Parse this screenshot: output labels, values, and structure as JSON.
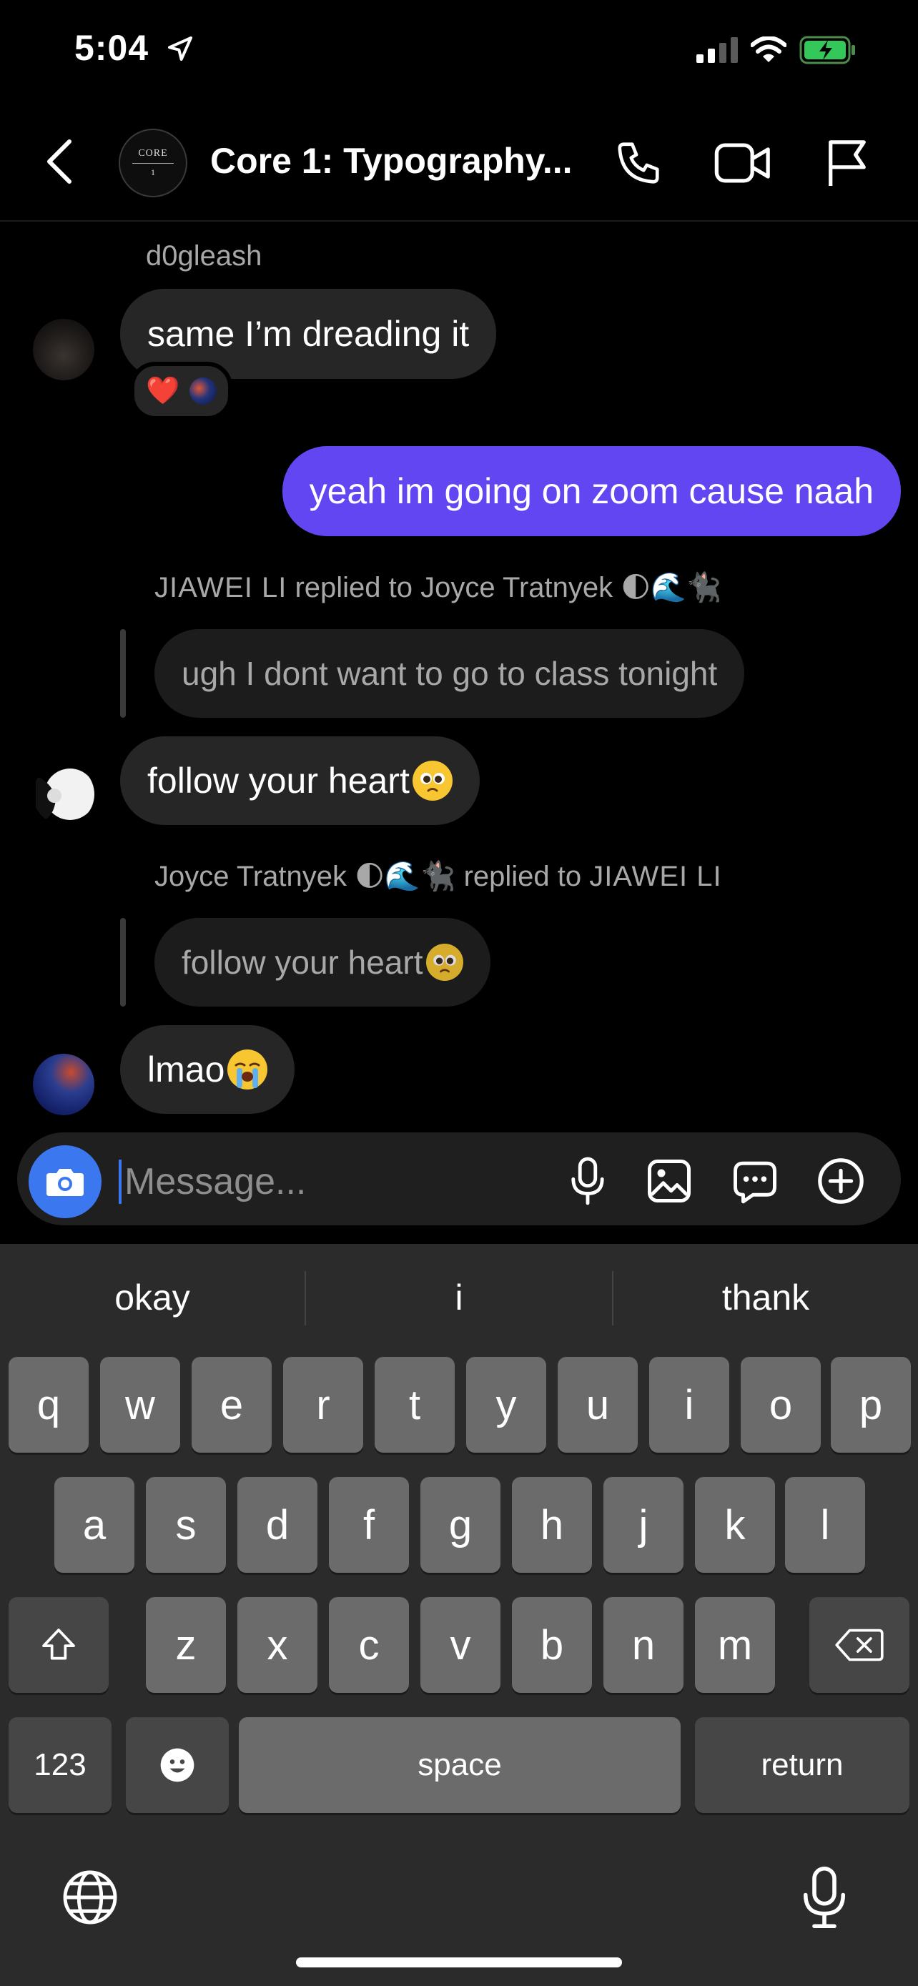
{
  "status_bar": {
    "time": "5:04"
  },
  "header": {
    "avatar_line1": "CORE",
    "avatar_line2": "1",
    "title": "Core 1: Typography..."
  },
  "messages": {
    "m1": {
      "sender": "d0gleash",
      "text": "same I’m dreading it",
      "reactions": [
        "❤️",
        "🌌"
      ]
    },
    "m2": {
      "text": "yeah im going on zoom cause naah"
    },
    "m3": {
      "reply_from": "JIAWEI LI",
      "reply_mid": "replied to",
      "reply_to": "Joyce Tratnyek 🌓🌊🐈‍⬛",
      "quoted": "ugh I dont want to go to class tonight",
      "text": "follow your heart"
    },
    "m4": {
      "reply_from": "Joyce Tratnyek 🌓🌊🐈‍⬛",
      "reply_mid": "replied to",
      "reply_to": "JIAWEI LI",
      "quoted": "follow your heart",
      "text": "lmao"
    }
  },
  "composer": {
    "placeholder": "Message..."
  },
  "keyboard": {
    "suggestions": [
      "okay",
      "i",
      "thank"
    ],
    "row1": [
      "q",
      "w",
      "e",
      "r",
      "t",
      "y",
      "u",
      "i",
      "o",
      "p"
    ],
    "row2": [
      "a",
      "s",
      "d",
      "f",
      "g",
      "h",
      "j",
      "k",
      "l"
    ],
    "row3": [
      "z",
      "x",
      "c",
      "v",
      "b",
      "n",
      "m"
    ],
    "numbers_label": "123",
    "space_label": "space",
    "return_label": "return"
  },
  "colors": {
    "outgoing_bubble": "#6246f2",
    "incoming_bubble": "#262626",
    "camera_button": "#3b78f0",
    "battery_fill": "#34c759"
  },
  "icons": [
    "location-arrow-icon",
    "signal-icon",
    "wifi-icon",
    "battery-charging-icon",
    "back-chevron-icon",
    "phone-icon",
    "video-icon",
    "flag-icon",
    "camera-icon",
    "mic-icon",
    "gallery-icon",
    "sticker-icon",
    "plus-icon",
    "shift-icon",
    "delete-icon",
    "emoji-icon",
    "globe-icon",
    "dictation-icon"
  ]
}
